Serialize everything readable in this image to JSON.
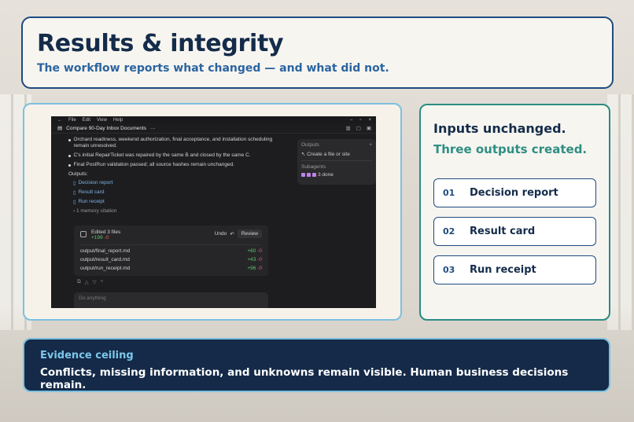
{
  "slide": {
    "title": "Results & integrity",
    "subtitle": "The workflow reports what changed — and what did not."
  },
  "app": {
    "menu": [
      "File",
      "Edit",
      "View",
      "Help"
    ],
    "tab_title": "Compare 90-Day Inbox Documents",
    "tab_more": "···",
    "bullets": [
      "Orchard readiness, weekend authorization, final acceptance, and installation scheduling remain unresolved.",
      "C's initial RepairTicket was repaired by the same B and closed by the same C.",
      "Final PostRun validation passed; all source hashes remain unchanged."
    ],
    "outputs_label": "Outputs:",
    "outputs": [
      "Decision report",
      "Result card",
      "Run receipt"
    ],
    "memory": "1 memory citation",
    "edit_panel": {
      "title": "Edited 3 files",
      "adds": "+199",
      "removes": "-0",
      "undo": "Undo",
      "review": "Review",
      "files": [
        {
          "path": "output/final_report.md",
          "adds": "+60",
          "removes": "-0"
        },
        {
          "path": "output/result_card.md",
          "adds": "+43",
          "removes": "-0"
        },
        {
          "path": "output/run_receipt.md",
          "adds": "+96",
          "removes": "-0"
        }
      ]
    },
    "composer_placeholder": "Do anything",
    "side_panel": {
      "outputs_header": "Outputs",
      "create": "Create a file or site",
      "subagents_header": "Subagents",
      "subagents_status": "3 done"
    }
  },
  "summary": {
    "line1": "Inputs unchanged.",
    "line2": "Three outputs created.",
    "items": [
      {
        "num": "01",
        "label": "Decision report"
      },
      {
        "num": "02",
        "label": "Result card"
      },
      {
        "num": "03",
        "label": "Run receipt"
      }
    ]
  },
  "evidence": {
    "heading": "Evidence ceiling",
    "text": "Conflicts, missing information, and unknowns remain visible. Human business decisions remain."
  },
  "colors": {
    "navy": "#142c4a",
    "blue": "#1f4a80",
    "teal": "#2e8e83",
    "sky": "#7cc0e0"
  }
}
